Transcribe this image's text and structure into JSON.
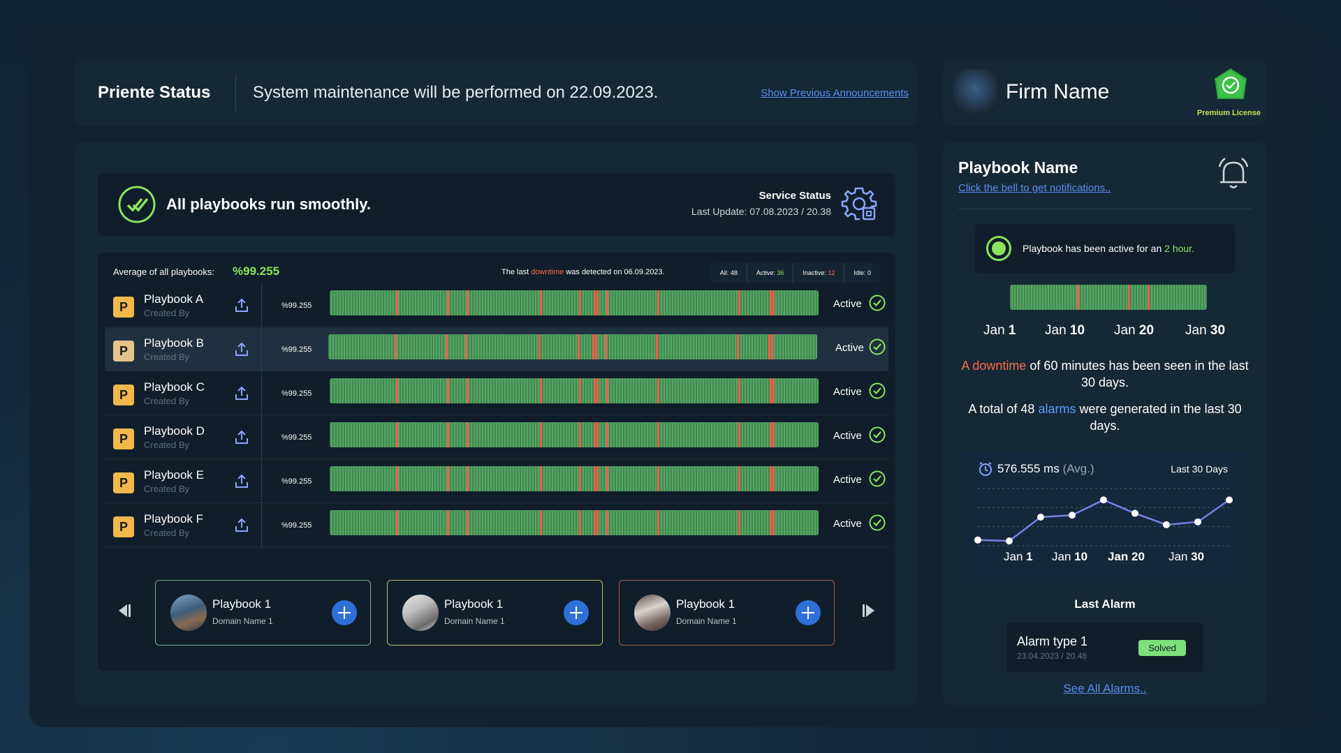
{
  "header": {
    "title": "Priente Status",
    "announcement": "System maintenance will be performed on 22.09.2023.",
    "previous_link": "Show Previous Announcements"
  },
  "firm": {
    "name": "Firm Name",
    "license": "Premium License",
    "badge_icon": "shield-check-icon"
  },
  "status": {
    "message": "All playbooks run smoothly.",
    "service_label": "Service Status",
    "last_update": "Last Update: 07.08.2023 / 20.38"
  },
  "table": {
    "avg_label": "Average of all playbooks:",
    "avg_value": "%99.255",
    "downtime_prefix": "The last ",
    "downtime_word": "downtime",
    "downtime_suffix": " was detected on 06.09.2023.",
    "counts": {
      "all": "All: 48",
      "active_label": "Active: ",
      "active": "36",
      "inactive_label": "Inactive: ",
      "inactive": "12",
      "idle": "Idle: 0"
    },
    "rows": [
      {
        "name": "Playbook A",
        "created": "Created By",
        "pct": "%99.255",
        "status": "Active",
        "letter": "P"
      },
      {
        "name": "Playbook B",
        "created": "Created By",
        "pct": "%99.255",
        "status": "Active",
        "letter": "P"
      },
      {
        "name": "Playbook C",
        "created": "Created By",
        "pct": "%99.255",
        "status": "Active",
        "letter": "P"
      },
      {
        "name": "Playbook D",
        "created": "Created By",
        "pct": "%99.255",
        "status": "Active",
        "letter": "P"
      },
      {
        "name": "Playbook E",
        "created": "Created By",
        "pct": "%99.255",
        "status": "Active",
        "letter": "P"
      },
      {
        "name": "Playbook F",
        "created": "Created By",
        "pct": "%99.255",
        "status": "Active",
        "letter": "P"
      }
    ],
    "downtime_marks": [
      0.135,
      0.24,
      0.28,
      0.43,
      0.51,
      0.54,
      0.545,
      0.565,
      0.67,
      0.835,
      0.9,
      0.905
    ]
  },
  "carousel": [
    {
      "name": "Playbook 1",
      "domain": "Domain Name 1",
      "border": "#6fae8f"
    },
    {
      "name": "Playbook 1",
      "domain": "Domain Name 1",
      "border": "#c5b96a"
    },
    {
      "name": "Playbook 1",
      "domain": "Domain Name 1",
      "border": "#b45a4a"
    }
  ],
  "side": {
    "playbook_name": "Playbook Name",
    "bell_link": "Click the bell to get notifications..",
    "active_prefix": "Playbook has been active for an ",
    "active_duration": "2 hour.",
    "timeline_marks": [
      0.34,
      0.6,
      0.7
    ],
    "dates": [
      "Jan ",
      "1",
      "Jan ",
      "10",
      "Jan ",
      "20",
      "Jan ",
      "30"
    ],
    "downtime_word": "A downtime",
    "downtime_rest": " of 60 minutes has been seen in the last 30 days.",
    "alarms_prefix": "A total of 48 ",
    "alarms_word": "alarms",
    "alarms_rest": " were generated in the last 30 days.",
    "response_value": "576.555 ms",
    "response_avg": " (Avg.)",
    "range_label": "Last 30 Days",
    "last_alarm_title": "Last Alarm",
    "alarm_type": "Alarm type 1",
    "alarm_time": "23.04.2023 / 20.48",
    "alarm_status": "Solved",
    "see_all": "See All Alarms.."
  },
  "chart_data": {
    "type": "line",
    "x": [
      0,
      1,
      2,
      3,
      4,
      5,
      6,
      7,
      8
    ],
    "values": [
      0.3,
      0.25,
      1.5,
      1.6,
      2.4,
      1.7,
      1.1,
      1.25,
      2.4
    ],
    "ylim": [
      0,
      3
    ],
    "tick_labels": [
      "Jan 1",
      "Jan 10",
      "Jan 20",
      "Jan 30"
    ],
    "line_color": "#7b7fe8",
    "grid": true
  }
}
